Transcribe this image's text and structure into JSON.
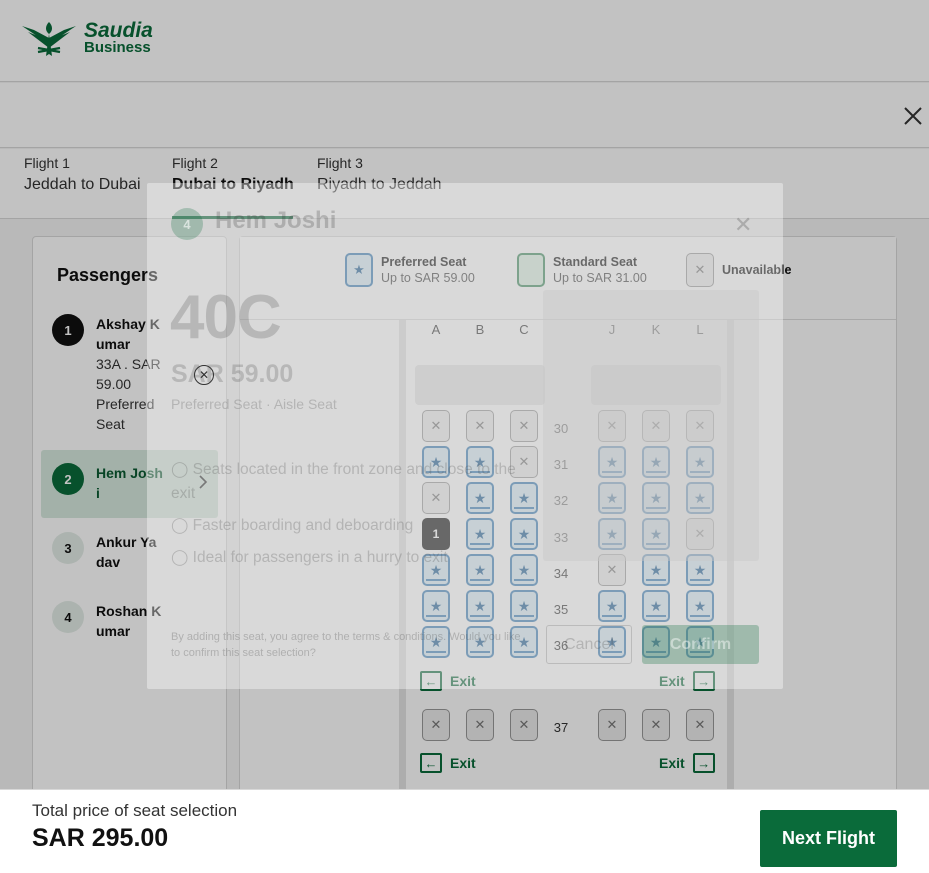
{
  "brand": {
    "name": "Saudia",
    "sub": "Business",
    "color": "#0a6b3a"
  },
  "header": {
    "close_icon": "close-icon"
  },
  "tabs": [
    {
      "label": "Flight 1",
      "route": "Jeddah to Dubai"
    },
    {
      "label": "Flight 2",
      "route": "Dubai to Riyadh"
    },
    {
      "label": "Flight 3",
      "route": "Riyadh to Jeddah"
    }
  ],
  "passengers": {
    "title": "Passengers",
    "list": [
      {
        "num": "1",
        "name": "Akshay K umar",
        "detail": "33A . SAR 59.00 Preferred Seat"
      },
      {
        "num": "2",
        "name": "Hem Josh i"
      },
      {
        "num": "3",
        "name": "Ankur Ya dav"
      },
      {
        "num": "4",
        "name": "Roshan K umar"
      }
    ]
  },
  "legend": {
    "preferred": {
      "title": "Preferred Seat",
      "price": "Up to SAR 59.00"
    },
    "standard": {
      "title": "Standard Seat",
      "price": "Up to SAR 31.00"
    },
    "unavailable": {
      "title": "Unavailable"
    }
  },
  "seatmap": {
    "columns": [
      "A",
      "B",
      "C",
      "J",
      "K",
      "L"
    ],
    "rows": [
      "30",
      "31",
      "32",
      "33",
      "34",
      "35",
      "36",
      "37"
    ],
    "exit_label": "Exit",
    "selected_label": "1"
  },
  "popup": {
    "passenger_num": "4",
    "passenger_name": "Hem Joshi",
    "seat": "40C",
    "price": "SAR 59.00",
    "type": "Preferred Seat · Aisle Seat",
    "features": [
      "Seats located in the front zone and close to the exit",
      "Faster boarding and deboarding",
      "Ideal for passengers in a hurry to exit"
    ],
    "legal": "By adding this seat, you agree to the terms & conditions. Would you like to confirm this seat selection?",
    "cancel": "Cancel",
    "confirm": "Confirm"
  },
  "footer": {
    "total_label": "Total price of seat selection",
    "total_value": "SAR 295.00",
    "next": "Next Flight"
  }
}
